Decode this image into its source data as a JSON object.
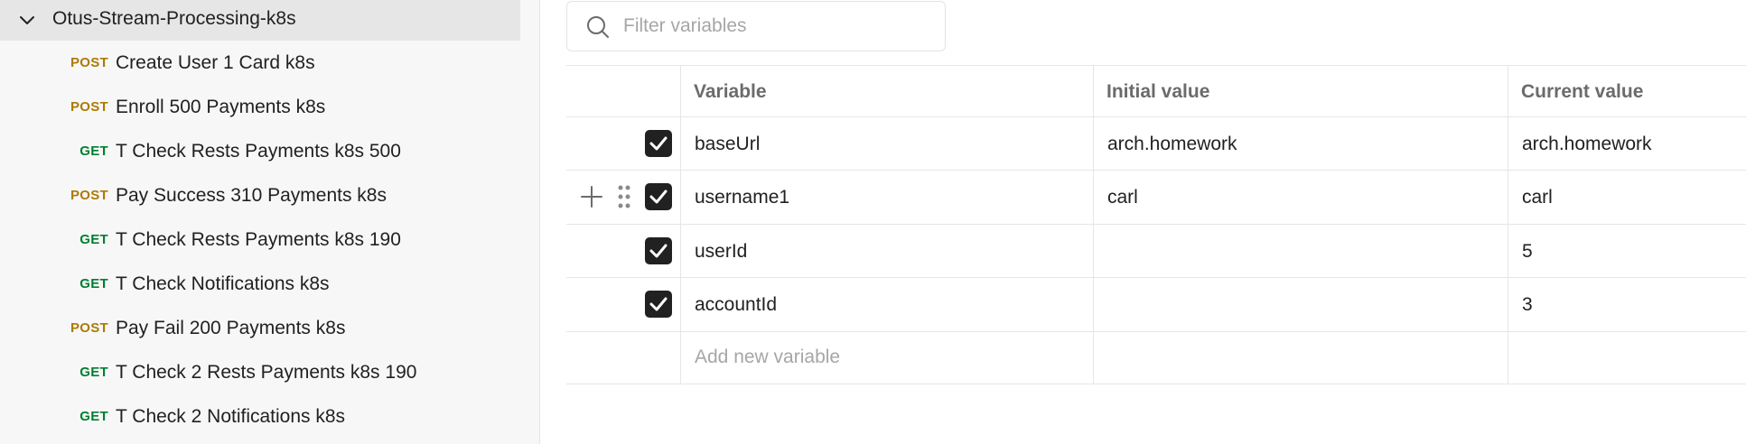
{
  "sidebar": {
    "collection": {
      "name": "Otus-Stream-Processing-k8s",
      "icon": "chevron-down-icon"
    },
    "requests": [
      {
        "method": "POST",
        "name": "Create User 1 Card k8s"
      },
      {
        "method": "POST",
        "name": "Enroll 500 Payments k8s"
      },
      {
        "method": "GET",
        "name": "T Check Rests Payments k8s 500"
      },
      {
        "method": "POST",
        "name": "Pay Success 310 Payments k8s"
      },
      {
        "method": "GET",
        "name": "T Check Rests Payments k8s 190"
      },
      {
        "method": "GET",
        "name": "T Check Notifications k8s"
      },
      {
        "method": "POST",
        "name": "Pay Fail 200 Payments k8s"
      },
      {
        "method": "GET",
        "name": "T Check 2 Rests Payments k8s 190"
      },
      {
        "method": "GET",
        "name": "T Check 2 Notifications k8s"
      }
    ]
  },
  "filter": {
    "placeholder": "Filter variables",
    "value": "",
    "icon": "search-icon"
  },
  "table": {
    "headers": {
      "variable": "Variable",
      "initial": "Initial value",
      "current": "Current value"
    },
    "rows": [
      {
        "enabled": true,
        "variable": "baseUrl",
        "initial": "arch.homework",
        "current": "arch.homework"
      },
      {
        "enabled": true,
        "variable": "username1",
        "initial": "carl",
        "current": "carl"
      },
      {
        "enabled": true,
        "variable": "userId",
        "initial": "",
        "current": "5"
      },
      {
        "enabled": true,
        "variable": "accountId",
        "initial": "",
        "current": "3"
      }
    ],
    "add_placeholder": "Add new variable"
  },
  "colors": {
    "post": "#ad7a03",
    "get": "#007f31",
    "checkbox": "#212121"
  }
}
